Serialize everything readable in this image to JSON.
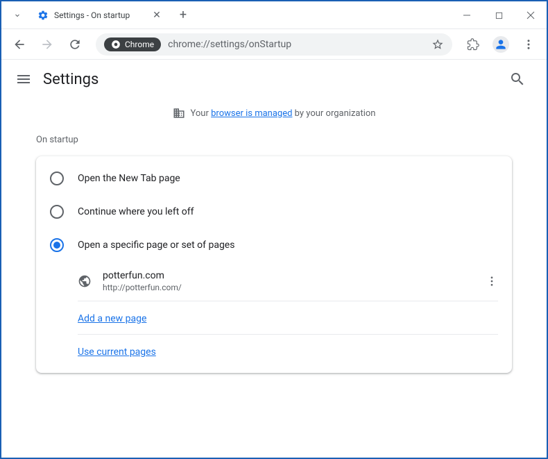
{
  "window": {
    "tab_title": "Settings - On startup"
  },
  "toolbar": {
    "chrome_chip": "Chrome",
    "url": "chrome://settings/onStartup"
  },
  "header": {
    "title": "Settings"
  },
  "managed": {
    "prefix": "Your ",
    "link": "browser is managed",
    "suffix": " by your organization"
  },
  "section": {
    "title": "On startup",
    "options": [
      {
        "label": "Open the New Tab page",
        "selected": false
      },
      {
        "label": "Continue where you left off",
        "selected": false
      },
      {
        "label": "Open a specific page or set of pages",
        "selected": true
      }
    ],
    "pages": [
      {
        "title": "potterfun.com",
        "url": "http://potterfun.com/"
      }
    ],
    "add_link": "Add a new page",
    "use_current": "Use current pages"
  }
}
